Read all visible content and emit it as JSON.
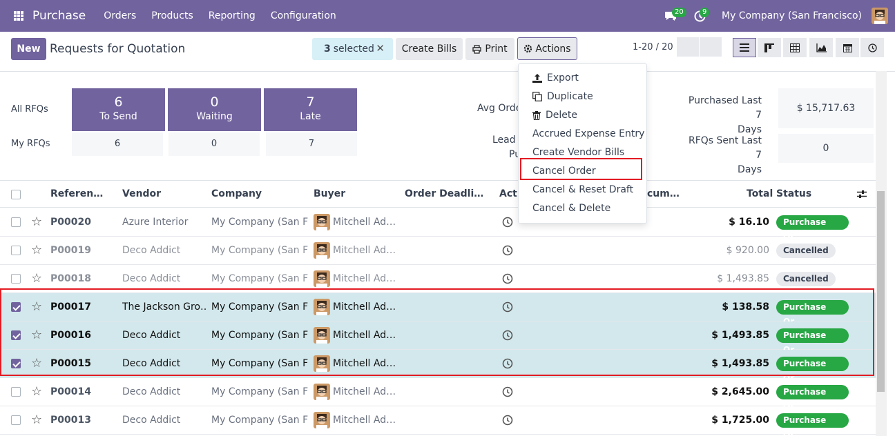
{
  "navbar": {
    "brand": "Purchase",
    "menu": [
      "Orders",
      "Products",
      "Reporting",
      "Configuration"
    ],
    "chat_count": "20",
    "activity_count": "9",
    "company": "My Company (San Francisco)"
  },
  "control": {
    "new_label": "New",
    "title": "Requests for Quotation",
    "selected_count": "3",
    "selected_label": "selected",
    "create_bills": "Create Bills",
    "print": "Print",
    "actions": "Actions",
    "pager": "1-20 / 20"
  },
  "dashboard": {
    "all_rfqs": "All RFQs",
    "my_rfqs": "My RFQs",
    "tiles": [
      {
        "num": "6",
        "label": "To Send",
        "my": "6"
      },
      {
        "num": "0",
        "label": "Waiting",
        "my": "0"
      },
      {
        "num": "7",
        "label": "Late",
        "my": "7"
      }
    ],
    "avg_order_partial": "Avg Orde",
    "lead_partial_1": "Lead T",
    "lead_partial_2": "Pu",
    "purchased_label_1": "Purchased Last 7",
    "purchased_label_2": "Days",
    "purchased_value": "$ 15,717.63",
    "rfqs_sent_label_1": "RFQs Sent Last 7",
    "rfqs_sent_label_2": "Days",
    "rfqs_sent_value": "0"
  },
  "table": {
    "headers": {
      "reference": "Referen…",
      "vendor": "Vendor",
      "company": "Company",
      "buyer": "Buyer",
      "deadline": "Order Deadli…",
      "activities": "Acti",
      "source": "cum…",
      "total": "Total",
      "status": "Status"
    },
    "rows": [
      {
        "ref": "P00020",
        "vendor": "Azure Interior",
        "company": "My Company (San F…",
        "buyer": "Mitchell Ad…",
        "total": "$ 16.10",
        "status": "Purchase Or…"
      },
      {
        "ref": "P00019",
        "vendor": "Deco Addict",
        "company": "My Company (San F…",
        "buyer": "Mitchell Ad…",
        "total": "$ 920.00",
        "status": "Cancelled"
      },
      {
        "ref": "P00018",
        "vendor": "Deco Addict",
        "company": "My Company (San F…",
        "buyer": "Mitchell Ad…",
        "total": "$ 1,493.85",
        "status": "Cancelled"
      },
      {
        "ref": "P00017",
        "vendor": "The Jackson Gro…",
        "company": "My Company (San F…",
        "buyer": "Mitchell Ad…",
        "total": "$ 138.58",
        "status": "Purchase Or…"
      },
      {
        "ref": "P00016",
        "vendor": "Deco Addict",
        "company": "My Company (San F…",
        "buyer": "Mitchell Ad…",
        "total": "$ 1,493.85",
        "status": "Purchase Or…"
      },
      {
        "ref": "P00015",
        "vendor": "Deco Addict",
        "company": "My Company (San F…",
        "buyer": "Mitchell Ad…",
        "total": "$ 1,493.85",
        "status": "Purchase Or…"
      },
      {
        "ref": "P00014",
        "vendor": "Deco Addict",
        "company": "My Company (San F…",
        "buyer": "Mitchell Ad…",
        "total": "$ 2,645.00",
        "status": "Purchase Or…"
      },
      {
        "ref": "P00013",
        "vendor": "Deco Addict",
        "company": "My Company (San F…",
        "buyer": "Mitchell Ad…",
        "total": "$ 1,725.00",
        "status": "Purchase Or…"
      }
    ]
  },
  "actions_menu": {
    "export": "Export",
    "duplicate": "Duplicate",
    "delete": "Delete",
    "accrued": "Accrued Expense Entry",
    "create_vendor_bills": "Create Vendor Bills",
    "cancel_order": "Cancel Order",
    "cancel_reset": "Cancel & Reset Draft",
    "cancel_delete": "Cancel & Delete"
  },
  "colors": {
    "brand": "#71639e",
    "success": "#28a745",
    "highlight": "#e31b23",
    "selected_row": "#d2e8ec"
  }
}
